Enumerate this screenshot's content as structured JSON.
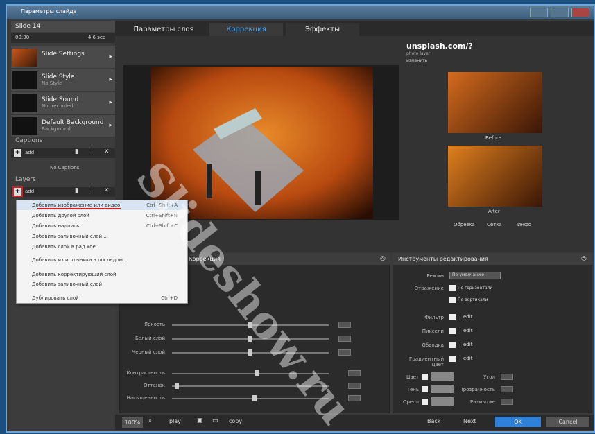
{
  "window": {
    "title": "Параметры слайда"
  },
  "sidebar": {
    "slide_title": "Slide 14",
    "time_left": "00:00",
    "time_right": "4.6 sec",
    "items": [
      {
        "title": "Slide Settings",
        "sub": ""
      },
      {
        "title": "Slide Style",
        "sub": "No Style"
      },
      {
        "title": "Slide Sound",
        "sub": "Not recorded"
      },
      {
        "title": "Default Background",
        "sub": "Background"
      }
    ],
    "captions_label": "Captions",
    "captions_add": "add",
    "captions_empty": "No Captions",
    "layers_label": "Layers",
    "layers_add": "add"
  },
  "context_menu": {
    "items": [
      {
        "label": "Добавить изображение или видео",
        "shortcut": "Ctrl+Shift+A"
      },
      {
        "label": "Добавить другой слой",
        "shortcut": "Ctrl+Shift+N"
      },
      {
        "label": "Добавить надпись",
        "shortcut": "Ctrl+Shift+C"
      },
      {
        "label": "Добавить заливочный слой...",
        "shortcut": ""
      },
      {
        "label": "Добавить слой в рад кое",
        "shortcut": ""
      },
      {
        "label": "Добавить из источника в последом...",
        "shortcut": ""
      },
      {
        "label": "Добавить корректирующий слой",
        "shortcut": ""
      },
      {
        "label": "Добавить заливочный слой",
        "shortcut": ""
      },
      {
        "label": "Дублировать слой",
        "shortcut": "Ctrl+D"
      }
    ]
  },
  "tabs": [
    {
      "label": "Параметры слоя"
    },
    {
      "label": "Коррекция"
    },
    {
      "label": "Эффекты"
    }
  ],
  "layer": {
    "name": "unsplash.com/?",
    "sub": "photo layer",
    "edit": "изменить",
    "before_label": "Before",
    "after_label": "After",
    "tools": [
      "Обрезка",
      "Сетка",
      "Инфо"
    ]
  },
  "adjust_panel": {
    "title": "Коррекция",
    "rows": [
      "Яркость",
      "Белый слой",
      "Черный слой",
      "Контрастность",
      "Оттенок",
      "Насыщенность"
    ]
  },
  "edit_panel": {
    "title": "Инструменты редактирования",
    "rows": [
      "Режим",
      "Отражение",
      "",
      "Фильтр",
      "Пиксели",
      "Обводка",
      "Градиентный цвет"
    ],
    "select_value": "По-умолчанию",
    "reflect_opts": [
      "По горизонтали",
      "По вертикали"
    ],
    "edit_label": "edit",
    "color_rows": [
      "Цвет",
      "Тень",
      "Ореол"
    ],
    "right_rows": [
      "Угол",
      "Прозрачность",
      "Размытие"
    ]
  },
  "bottom": {
    "zoom": "100%",
    "play": "play",
    "copy": "copy",
    "back": "Back",
    "next": "Next",
    "ok": "OK",
    "cancel": "Cancel"
  },
  "watermark": {
    "text": "Slideshow.ru"
  },
  "colors": {
    "accent": "#4aa3f0",
    "ok": "#2f80d8",
    "sidebar": "#3c3c3c",
    "highlight": "#c22"
  }
}
